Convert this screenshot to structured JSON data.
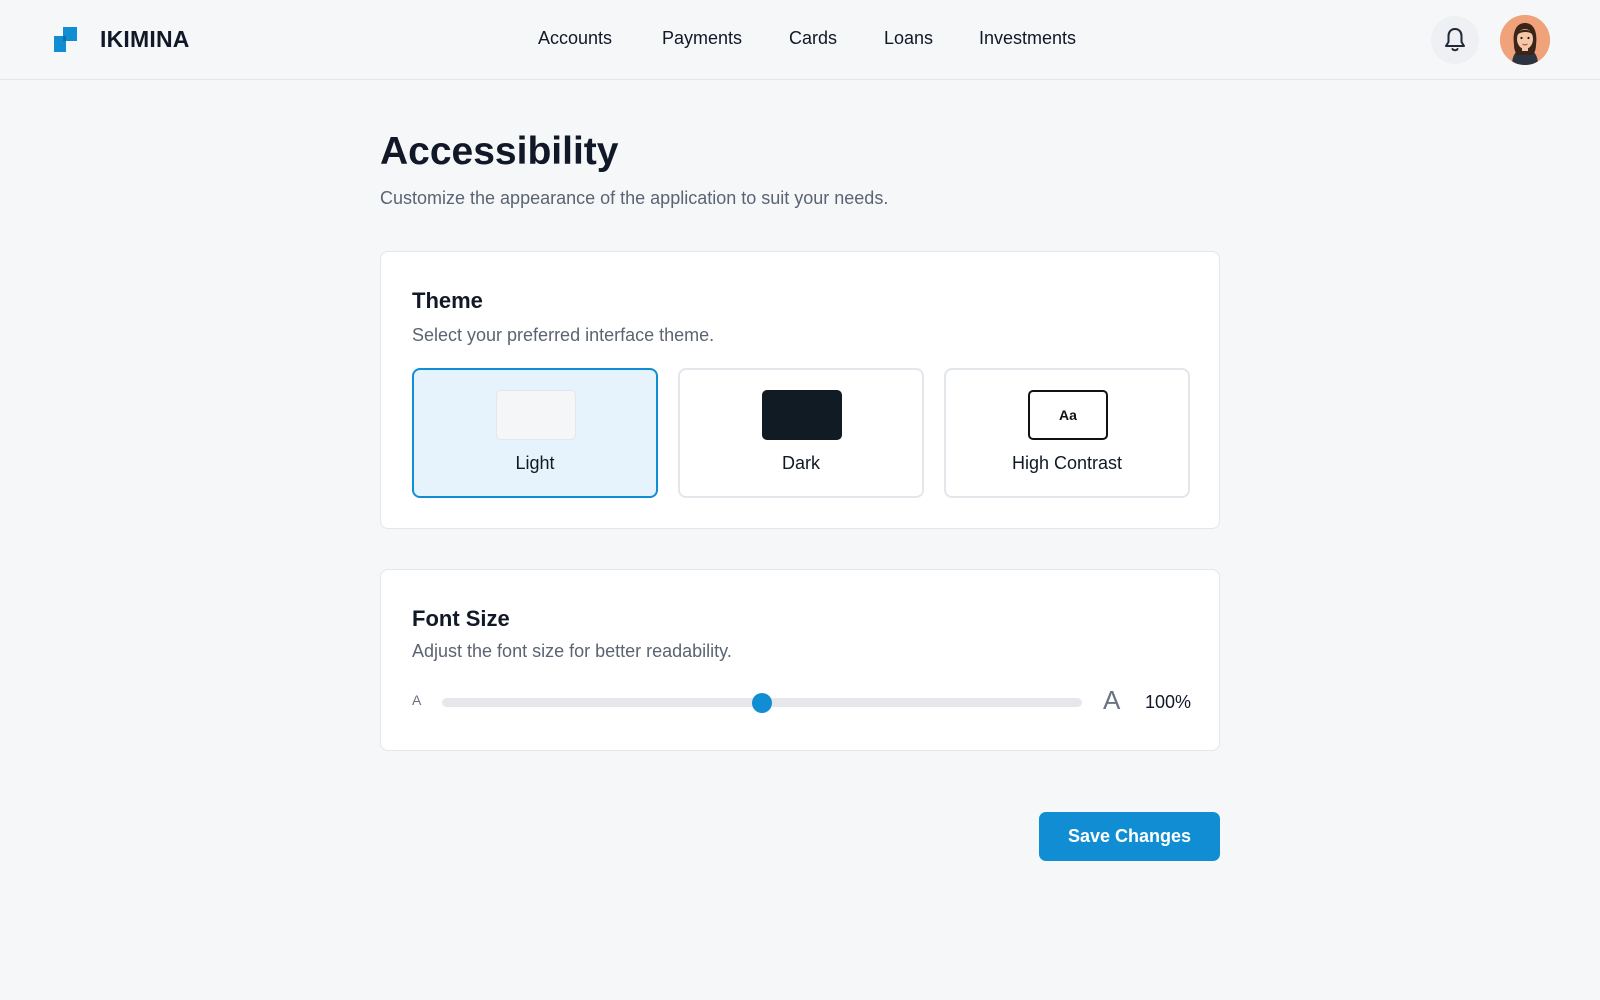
{
  "header": {
    "brand": "IKIMINA",
    "nav": [
      "Accounts",
      "Payments",
      "Cards",
      "Loans",
      "Investments"
    ],
    "notification_icon": "bell-icon",
    "avatar_icon": "user-avatar"
  },
  "page": {
    "title": "Accessibility",
    "subtitle": "Customize the appearance of the application to suit your needs."
  },
  "theme": {
    "title": "Theme",
    "description": "Select your preferred interface theme.",
    "options": [
      {
        "label": "Light",
        "selected": true,
        "swatch_color": "#f5f6f7"
      },
      {
        "label": "Dark",
        "selected": false,
        "swatch_color": "#111b24"
      },
      {
        "label": "High Contrast",
        "selected": false,
        "swatch_text": "Aa"
      }
    ]
  },
  "font_size": {
    "title": "Font Size",
    "description": "Adjust the font size for better readability.",
    "small_label": "A",
    "large_label": "A",
    "value_label": "100%",
    "slider_fraction": 0.5
  },
  "actions": {
    "save_label": "Save Changes"
  },
  "colors": {
    "accent": "#118ed3",
    "background": "#f5f7f9",
    "text_primary": "#111827",
    "text_secondary": "#5b6472"
  }
}
